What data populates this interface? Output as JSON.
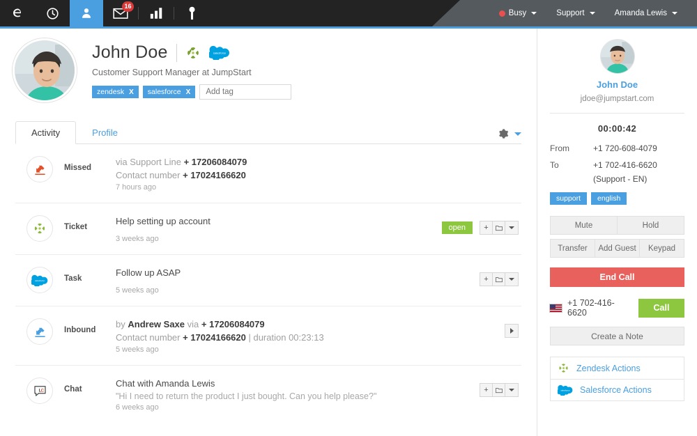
{
  "topnav": {
    "icons": [
      {
        "name": "echo-logo-icon",
        "glyph": "e"
      },
      {
        "name": "clock-icon",
        "glyph": "clock"
      },
      {
        "name": "contacts-icon",
        "glyph": "person"
      },
      {
        "name": "mail-icon",
        "glyph": "envelope",
        "badge": "16"
      },
      {
        "name": "stats-icon",
        "glyph": "bars"
      },
      {
        "name": "key-icon",
        "glyph": "key"
      }
    ],
    "status": {
      "label": "Busy",
      "color": "#e8504f"
    },
    "team": {
      "label": "Support"
    },
    "user": {
      "label": "Amanda Lewis"
    }
  },
  "profile": {
    "name": "John Doe",
    "subtitle": "Customer Support Manager at JumpStart",
    "integrations": [
      "zendesk-icon",
      "salesforce-icon"
    ],
    "tags": [
      {
        "label": "zendesk",
        "remove": "X"
      },
      {
        "label": "salesforce",
        "remove": "X"
      }
    ],
    "tag_input_placeholder": "Add tag"
  },
  "tabs": [
    {
      "label": "Activity",
      "active": true
    },
    {
      "label": "Profile",
      "active": false
    }
  ],
  "activity": [
    {
      "icon": "missed-call-icon",
      "type": "Missed",
      "line1_label": "via Support Line",
      "line1_value": "+ 17206084079",
      "line2_label": "Contact number",
      "line2_value": "+ 17024166620",
      "time": "7 hours ago",
      "badge": null,
      "buttons": "none"
    },
    {
      "icon": "zendesk-icon",
      "type": "Ticket",
      "title": "Help setting up account",
      "time": "3 weeks ago",
      "badge": "open",
      "buttons": "group"
    },
    {
      "icon": "salesforce-icon",
      "type": "Task",
      "title": "Follow up ASAP",
      "time": "5 weeks ago",
      "badge": null,
      "buttons": "group"
    },
    {
      "icon": "inbound-call-icon",
      "type": "Inbound",
      "by_label": "by",
      "by_name": "Andrew Saxe",
      "via_label": "via",
      "via_value": "+ 17206084079",
      "line2_label": "Contact number",
      "line2_value": "+ 17024166620",
      "duration_label": "| duration 00:23:13",
      "time": "5 weeks ago",
      "badge": null,
      "buttons": "play"
    },
    {
      "icon": "livechat-icon",
      "type": "Chat",
      "title": "Chat with Amanda Lewis",
      "quote": "\"Hi I need to return the product I just bought. Can you help please?\"",
      "time": "6 weeks ago",
      "badge": null,
      "buttons": "group"
    }
  ],
  "sidebar": {
    "contact_name": "John Doe",
    "contact_email": "jdoe@jumpstart.com",
    "timer": "00:00:42",
    "from_label": "From",
    "from_value": "+1 720-608-4079",
    "to_label": "To",
    "to_value": "+1 702-416-6620",
    "to_sub": "(Support - EN)",
    "tags": [
      "support",
      "english"
    ],
    "call_buttons": {
      "mute": "Mute",
      "hold": "Hold",
      "transfer": "Transfer",
      "add_guest": "Add Guest",
      "keypad": "Keypad",
      "end_call": "End Call"
    },
    "dial_number": "+1 702-416-6620",
    "call_button": "Call",
    "note_button": "Create a Note",
    "actions": [
      {
        "label": "Zendesk Actions",
        "icon": "zendesk-icon"
      },
      {
        "label": "Salesforce Actions",
        "icon": "salesforce-icon"
      }
    ]
  }
}
